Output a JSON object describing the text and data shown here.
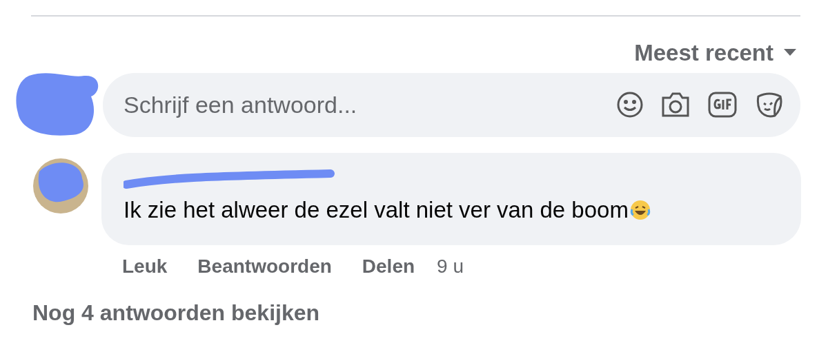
{
  "sort": {
    "label": "Meest recent"
  },
  "reply_field": {
    "placeholder": "Schrijf een antwoord..."
  },
  "comment": {
    "text": "Ik zie het alweer de ezel valt niet ver van de boom",
    "actions": [
      {
        "label": "Leuk"
      },
      {
        "label": "Beantwoorden"
      },
      {
        "label": "Delen"
      }
    ],
    "time": "9 u"
  },
  "more_replies": "Nog 4 antwoorden bekijken"
}
